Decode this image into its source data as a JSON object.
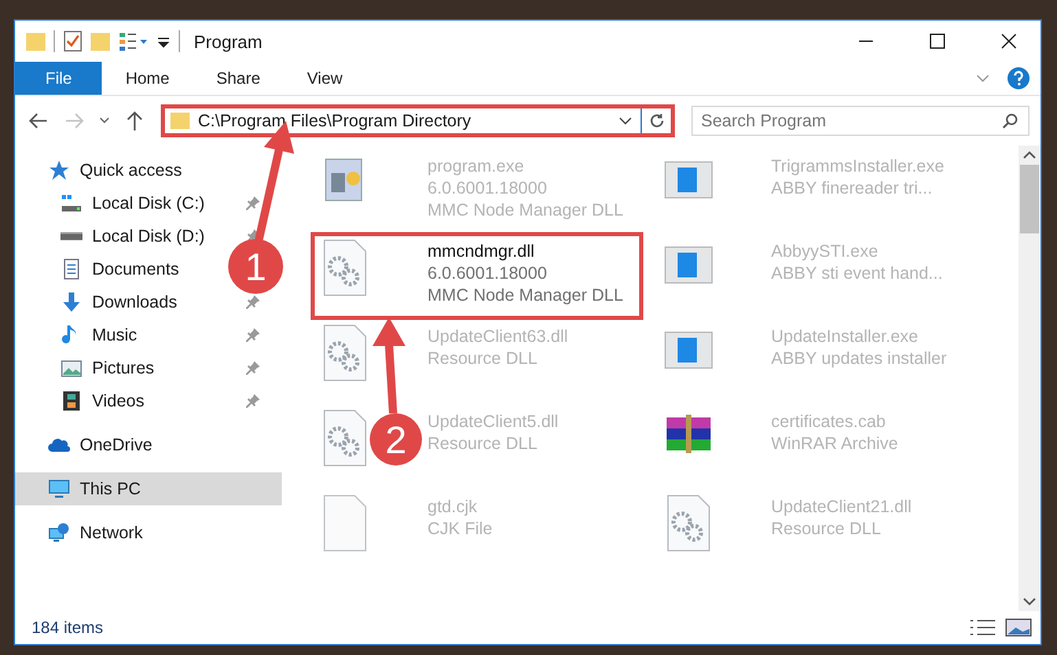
{
  "window": {
    "title": "Program"
  },
  "ribbon_tabs": [
    {
      "label": "File",
      "kind": "file"
    },
    {
      "label": "Home",
      "kind": "tab"
    },
    {
      "label": "Share",
      "kind": "tab"
    },
    {
      "label": "View",
      "kind": "tab"
    }
  ],
  "address_bar": {
    "path": "C:\\Program Files\\Program Directory",
    "highlighted": true
  },
  "search": {
    "placeholder": "Search Program"
  },
  "navigation": [
    {
      "label": "Quick access",
      "kind": "star",
      "selected": false,
      "children": [
        {
          "label": "Local Disk (C:)",
          "kind": "system-drive",
          "pinned": true,
          "selected": false
        },
        {
          "label": "Local Disk (D:)",
          "kind": "drive",
          "pinned": true,
          "selected": false
        },
        {
          "label": "Documents",
          "kind": "documents",
          "selected": false
        },
        {
          "label": "Downloads",
          "kind": "downloads",
          "pinned": true,
          "selected": false
        },
        {
          "label": "Music",
          "kind": "music",
          "pinned": true,
          "selected": false
        },
        {
          "label": "Pictures",
          "kind": "pictures",
          "pinned": true,
          "selected": false
        },
        {
          "label": "Videos",
          "kind": "videos",
          "pinned": true,
          "selected": false
        }
      ]
    },
    {
      "label": "OneDrive",
      "kind": "cloud",
      "selected": false
    },
    {
      "label": "This PC",
      "kind": "pc",
      "selected": true
    },
    {
      "label": "Network",
      "kind": "network",
      "selected": false
    }
  ],
  "files": [
    {
      "name": "program.exe",
      "details": [
        "6.0.6001.18000",
        "MMC Node Manager DLL"
      ],
      "kind": "program",
      "dimmed": true,
      "highlighted": false
    },
    {
      "name": "TrigrammsInstaller.exe",
      "details": [
        "ABBY finereader tri..."
      ],
      "kind": "app",
      "dimmed": true,
      "highlighted": false
    },
    {
      "name": "mmcndmgr.dll",
      "details": [
        "6.0.6001.18000",
        "MMC Node Manager DLL"
      ],
      "kind": "dll",
      "dimmed": false,
      "highlighted": true
    },
    {
      "name": "AbbyySTI.exe",
      "details": [
        "ABBY sti event hand..."
      ],
      "kind": "app",
      "dimmed": true,
      "highlighted": false
    },
    {
      "name": "UpdateClient63.dll",
      "details": [
        "Resource DLL"
      ],
      "kind": "dll",
      "dimmed": true,
      "highlighted": false
    },
    {
      "name": "UpdateInstaller.exe",
      "details": [
        "ABBY updates installer"
      ],
      "kind": "app",
      "dimmed": true,
      "highlighted": false
    },
    {
      "name": "UpdateClient5.dll",
      "details": [
        "Resource DLL"
      ],
      "kind": "dll",
      "dimmed": true,
      "highlighted": false
    },
    {
      "name": "certificates.cab",
      "details": [
        "WinRAR Archive"
      ],
      "kind": "archive",
      "dimmed": true,
      "highlighted": false
    },
    {
      "name": "gtd.cjk",
      "details": [
        "CJK File"
      ],
      "kind": "blank",
      "dimmed": true,
      "highlighted": false
    },
    {
      "name": "UpdateClient21.dll",
      "details": [
        "Resource DLL"
      ],
      "kind": "dll",
      "dimmed": true,
      "highlighted": false
    }
  ],
  "status_bar": {
    "count": "184 items"
  },
  "callouts": [
    {
      "number": "1"
    },
    {
      "number": "2"
    }
  ]
}
